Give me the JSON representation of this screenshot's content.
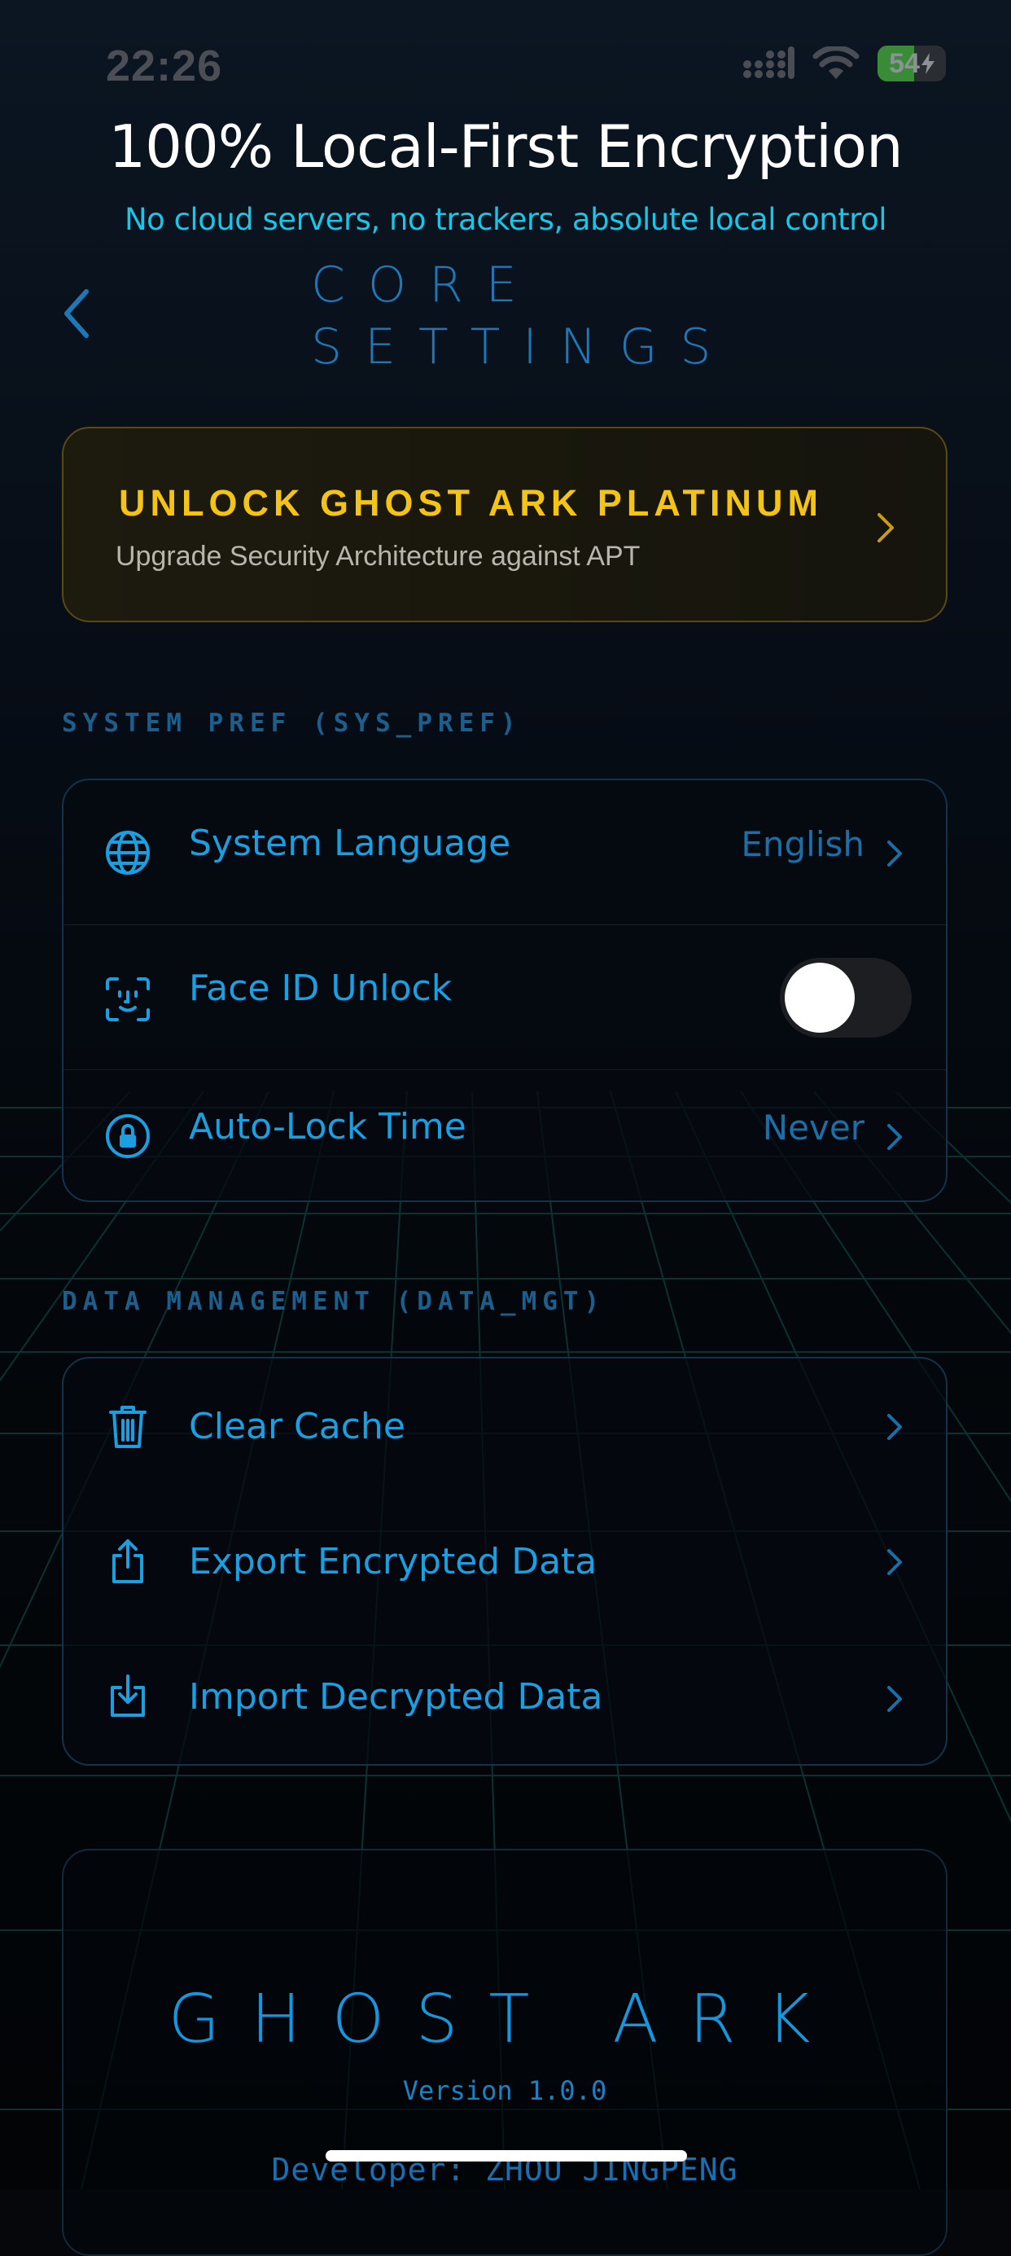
{
  "status": {
    "time": "22:26",
    "battery": "54",
    "battery_level": 0.54
  },
  "hero": {
    "title": "100% Local-First Encryption",
    "subtitle": "No cloud servers, no trackers, absolute local control"
  },
  "header": {
    "title": "CORE SETTINGS"
  },
  "promo": {
    "title": "UNLOCK GHOST ARK PLATINUM",
    "subtitle": "Upgrade Security Architecture against APT"
  },
  "system_pref": {
    "section_label": "SYSTEM PREF (SYS_PREF)",
    "items": [
      {
        "label": "System Language",
        "value": "English",
        "icon": "globe-icon"
      },
      {
        "label": "Face ID Unlock",
        "toggle_on": false,
        "icon": "face-id-icon"
      },
      {
        "label": "Auto-Lock Time",
        "value": "Never",
        "icon": "lock-icon"
      }
    ]
  },
  "data_mgt": {
    "section_label": "DATA MANAGEMENT (DATA_MGT)",
    "items": [
      {
        "label": "Clear Cache",
        "icon": "trash-icon"
      },
      {
        "label": "Export Encrypted Data",
        "icon": "share-export-icon"
      },
      {
        "label": "Import Decrypted Data",
        "icon": "import-tray-icon"
      }
    ]
  },
  "about": {
    "brand": "GHOST ARK",
    "version": "Version 1.0.0",
    "developer": "Developer: ZHOU JINGPENG"
  },
  "colors": {
    "accent": "#1a9fe0",
    "hero_subtitle": "#18c6e8",
    "gold": "#f3c316",
    "background": "#05070b"
  }
}
